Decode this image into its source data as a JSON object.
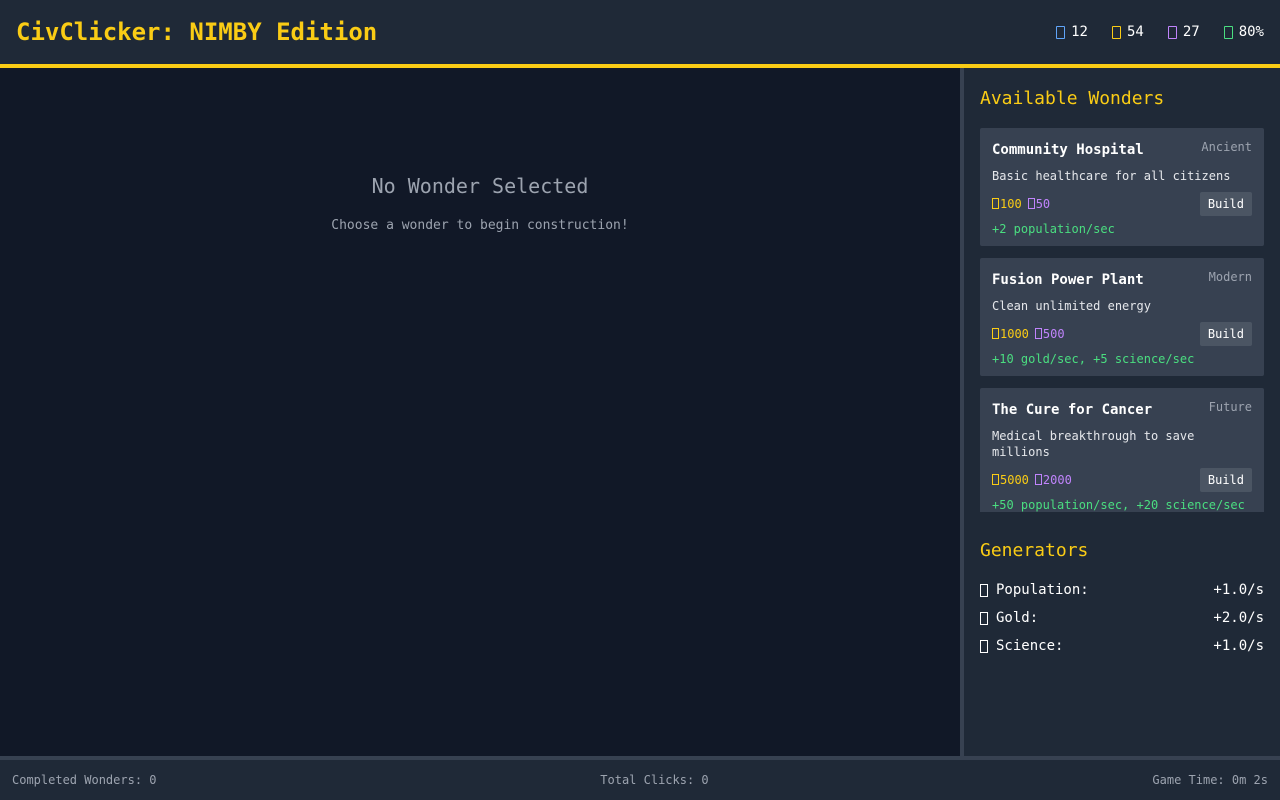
{
  "header": {
    "title": "CivClicker: NIMBY Edition",
    "resources": [
      {
        "icon": "population-icon",
        "value": "12",
        "color": "#60a5fa"
      },
      {
        "icon": "gold-icon",
        "value": "54",
        "color": "#facc15"
      },
      {
        "icon": "science-icon",
        "value": "27",
        "color": "#c084fc"
      },
      {
        "icon": "happiness-icon",
        "value": "80%",
        "color": "#4ade80"
      }
    ]
  },
  "main": {
    "empty_title": "No Wonder Selected",
    "empty_subtitle": "Choose a wonder to begin construction!"
  },
  "sidebar": {
    "wonders_title": "Available Wonders",
    "wonders": [
      {
        "name": "Community Hospital",
        "era": "Ancient",
        "description": "Basic healthcare for all citizens",
        "cost_gold": "100",
        "cost_science": "50",
        "build_label": "Build",
        "effect": "+2 population/sec"
      },
      {
        "name": "Fusion Power Plant",
        "era": "Modern",
        "description": "Clean unlimited energy",
        "cost_gold": "1000",
        "cost_science": "500",
        "build_label": "Build",
        "effect": "+10 gold/sec, +5 science/sec"
      },
      {
        "name": "The Cure for Cancer",
        "era": "Future",
        "description": "Medical breakthrough to save millions",
        "cost_gold": "5000",
        "cost_science": "2000",
        "build_label": "Build",
        "effect": "+50 population/sec, +20 science/sec"
      }
    ],
    "generators_title": "Generators",
    "generators": [
      {
        "icon": "population-icon",
        "label": "Population:",
        "rate": "+1.0/s"
      },
      {
        "icon": "gold-icon",
        "label": "Gold:",
        "rate": "+2.0/s"
      },
      {
        "icon": "science-icon",
        "label": "Science:",
        "rate": "+1.0/s"
      }
    ]
  },
  "footer": {
    "completed": "Completed Wonders: 0",
    "clicks": "Total Clicks: 0",
    "game_time": "Game Time: 0m 2s"
  },
  "colors": {
    "accent": "#facc15",
    "effect": "#4ade80",
    "science": "#c084fc"
  }
}
